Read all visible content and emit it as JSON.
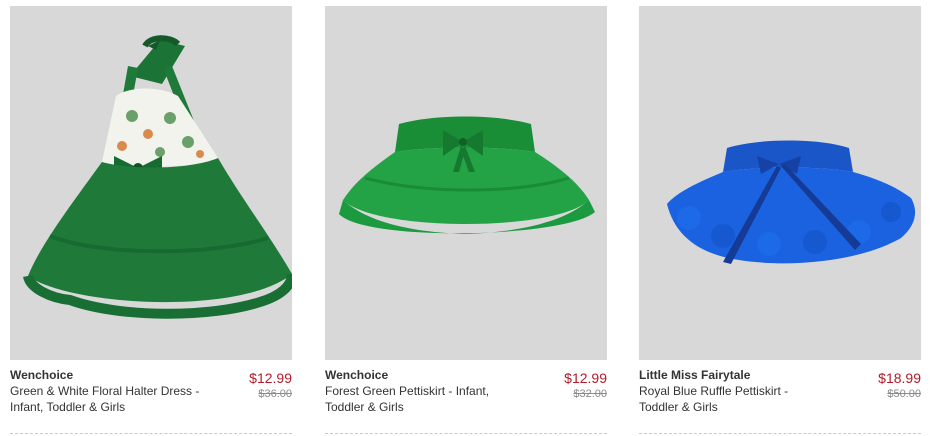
{
  "products": [
    {
      "brand": "Wenchoice",
      "name": "Green & White Floral Halter Dress - Infant, Toddler & Girls",
      "price": "$12.99",
      "original_price": "$36.00",
      "image": "green-floral-halter-dress",
      "color": "#1f7a3a"
    },
    {
      "brand": "Wenchoice",
      "name": "Forest Green Pettiskirt - Infant, Toddler & Girls",
      "price": "$12.99",
      "original_price": "$32.00",
      "image": "forest-green-pettiskirt",
      "color": "#1e9a3c"
    },
    {
      "brand": "Little Miss Fairytale",
      "name": "Royal Blue Ruffle Pettiskirt - Toddler & Girls",
      "price": "$18.99",
      "original_price": "$50.00",
      "image": "royal-blue-ruffle-pettiskirt",
      "color": "#1858d6"
    }
  ],
  "colors": {
    "price": "#b11b2b",
    "image_bg": "#d8d8d9"
  }
}
